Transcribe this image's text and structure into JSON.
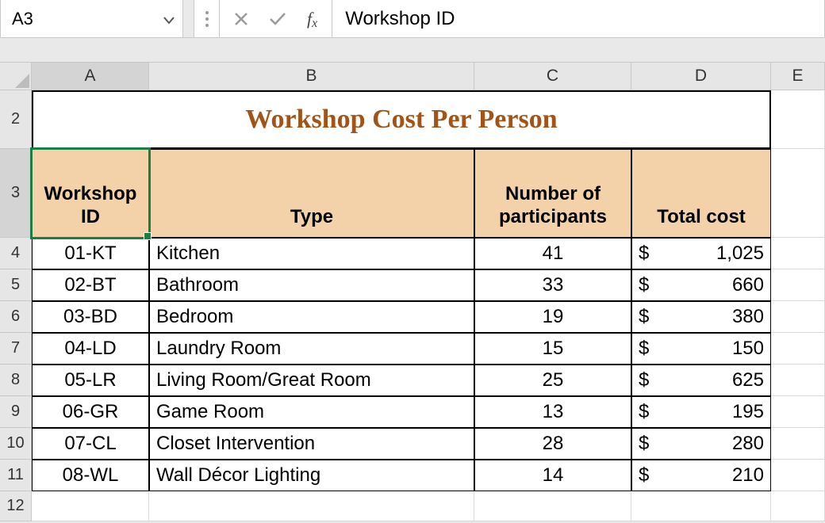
{
  "formula_bar": {
    "name_box_value": "A3",
    "cell_content": "Workshop ID"
  },
  "columns": [
    "A",
    "B",
    "C",
    "D",
    "E"
  ],
  "selected_column": "A",
  "selected_row": 3,
  "title_row_num": 2,
  "title": "Workshop Cost Per Person",
  "header_row_num": 3,
  "headers": {
    "a": "Workshop ID",
    "b": "Type",
    "c": "Number of participants",
    "d": "Total cost"
  },
  "data_start_row": 4,
  "currency_symbol": "$",
  "rows": [
    {
      "id": "01-KT",
      "type": "Kitchen",
      "participants": 41,
      "cost": "1,025"
    },
    {
      "id": "02-BT",
      "type": "Bathroom",
      "participants": 33,
      "cost": "660"
    },
    {
      "id": "03-BD",
      "type": "Bedroom",
      "participants": 19,
      "cost": "380"
    },
    {
      "id": "04-LD",
      "type": "Laundry Room",
      "participants": 15,
      "cost": "150"
    },
    {
      "id": "05-LR",
      "type": "Living Room/Great Room",
      "participants": 25,
      "cost": "625"
    },
    {
      "id": "06-GR",
      "type": "Game Room",
      "participants": 13,
      "cost": "195"
    },
    {
      "id": "07-CL",
      "type": "Closet Intervention",
      "participants": 28,
      "cost": "280"
    },
    {
      "id": "08-WL",
      "type": "Wall Décor Lighting",
      "participants": 14,
      "cost": "210"
    }
  ],
  "empty_row_num": 12,
  "chart_data": {
    "type": "table",
    "title": "Workshop Cost Per Person",
    "columns": [
      "Workshop ID",
      "Type",
      "Number of participants",
      "Total cost"
    ],
    "rows": [
      [
        "01-KT",
        "Kitchen",
        41,
        1025
      ],
      [
        "02-BT",
        "Bathroom",
        33,
        660
      ],
      [
        "03-BD",
        "Bedroom",
        19,
        380
      ],
      [
        "04-LD",
        "Laundry Room",
        15,
        150
      ],
      [
        "05-LR",
        "Living Room/Great Room",
        25,
        625
      ],
      [
        "06-GR",
        "Game Room",
        13,
        195
      ],
      [
        "07-CL",
        "Closet Intervention",
        28,
        280
      ],
      [
        "08-WL",
        "Wall Décor Lighting",
        14,
        210
      ]
    ]
  }
}
